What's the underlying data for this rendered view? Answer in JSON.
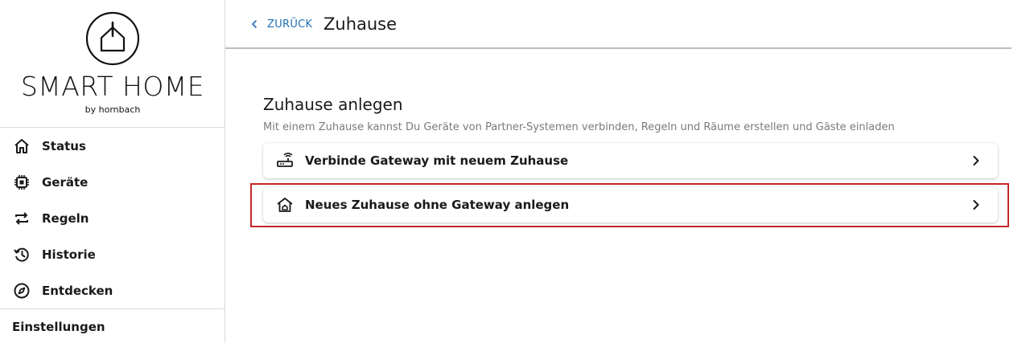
{
  "brand": {
    "title": "SMART HOME",
    "subtitle": "by hornbach"
  },
  "sidebar": {
    "items": [
      {
        "label": "Status",
        "icon": "home-icon"
      },
      {
        "label": "Geräte",
        "icon": "chip-icon"
      },
      {
        "label": "Regeln",
        "icon": "repeat-icon"
      },
      {
        "label": "Historie",
        "icon": "history-icon"
      },
      {
        "label": "Entdecken",
        "icon": "compass-icon"
      }
    ],
    "settings_label": "Einstellungen"
  },
  "header": {
    "back_label": "ZURÜCK",
    "title": "Zuhause"
  },
  "main": {
    "section_title": "Zuhause anlegen",
    "section_description": "Mit einem Zuhause kannst Du Geräte von Partner-Systemen verbinden, Regeln und Räume erstellen und Gäste einladen",
    "options": [
      {
        "label": "Verbinde Gateway mit neuem Zuhause",
        "icon": "router-icon"
      },
      {
        "label": "Neues Zuhause ohne Gateway anlegen",
        "icon": "house-plus-icon"
      }
    ]
  },
  "colors": {
    "accent": "#1f6fb5",
    "highlight": "#c62828",
    "text": "#1a1a1a",
    "muted": "#7a7a7a"
  }
}
